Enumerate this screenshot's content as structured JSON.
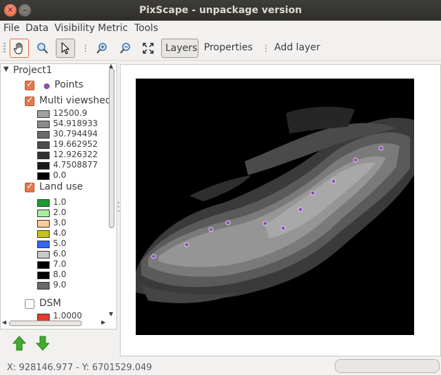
{
  "window": {
    "title": "PixScape - unpackage version"
  },
  "menubar": {
    "items": [
      "File",
      "Data",
      "Visibility",
      "Metric",
      "Tools"
    ]
  },
  "toolbar": {
    "layers_label": "Layers",
    "properties_label": "Properties",
    "add_layer_label": "Add layer",
    "icons": [
      "hand-pan-icon",
      "zoom-window-icon",
      "pointer-select-icon",
      "zoom-in-icon",
      "zoom-out-icon",
      "zoom-extent-icon"
    ]
  },
  "layers": {
    "project_name": "Project1",
    "points": {
      "label": "Points",
      "checked": true,
      "color": "#8a4fb0"
    },
    "multi_viewshed": {
      "label": "Multi viewshed",
      "checked": true,
      "legend": [
        {
          "value": "12500.9",
          "color": "#a0a0a0"
        },
        {
          "value": "54.918933",
          "color": "#8a8a8a"
        },
        {
          "value": "30.794494",
          "color": "#6a6a6a"
        },
        {
          "value": "19.662952",
          "color": "#4c4c4c"
        },
        {
          "value": "12.926322",
          "color": "#323232"
        },
        {
          "value": "4.7508877",
          "color": "#1a1a1a"
        },
        {
          "value": "0.0",
          "color": "#000000"
        }
      ]
    },
    "land_use": {
      "label": "Land use",
      "checked": true,
      "legend": [
        {
          "value": "1.0",
          "color": "#1a9c2e"
        },
        {
          "value": "2.0",
          "color": "#a7ef9c"
        },
        {
          "value": "3.0",
          "color": "#ffcc9a"
        },
        {
          "value": "4.0",
          "color": "#c9c21a"
        },
        {
          "value": "5.0",
          "color": "#3366ff"
        },
        {
          "value": "6.0",
          "color": "#c8c8c8"
        },
        {
          "value": "7.0",
          "color": "#000000"
        },
        {
          "value": "8.0",
          "color": "#050505"
        },
        {
          "value": "9.0",
          "color": "#6a6a6a"
        }
      ]
    },
    "dsm": {
      "label": "DSM",
      "checked": false,
      "legend_first": "1.0000",
      "legend_color": "#e33a2a"
    }
  },
  "status": {
    "coordinates": "X: 928146.977 - Y: 6701529.049"
  }
}
